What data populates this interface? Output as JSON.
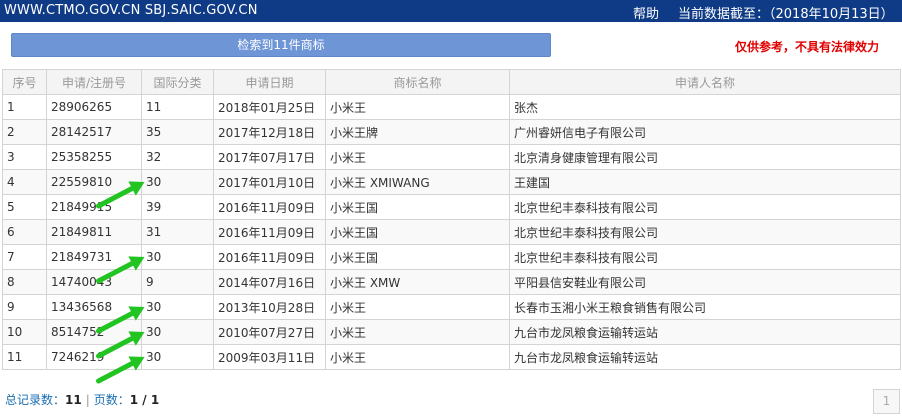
{
  "topbar": {
    "site": "WWW.CTMO.GOV.CN  SBJ.SAIC.GOV.CN",
    "help": "帮助",
    "as_of": "当前数据截至：（2018年10月13日）"
  },
  "search": {
    "result_label": "检索到11件商标",
    "disclaimer": "仅供参考，不具有法律效力"
  },
  "table": {
    "headers": [
      "序号",
      "申请/注册号",
      "国际分类",
      "申请日期",
      "商标名称",
      "申请人名称"
    ],
    "rows": [
      {
        "no": "1",
        "reg": "28906265",
        "cls": "11",
        "date": "2018年01月25日",
        "mark": "小米王",
        "applicant": "张杰"
      },
      {
        "no": "2",
        "reg": "28142517",
        "cls": "35",
        "date": "2017年12月18日",
        "mark": "小米王牌",
        "applicant": "广州睿妍信电子有限公司"
      },
      {
        "no": "3",
        "reg": "25358255",
        "cls": "32",
        "date": "2017年07月17日",
        "mark": "小米王",
        "applicant": "北京清身健康管理有限公司"
      },
      {
        "no": "4",
        "reg": "22559810",
        "cls": "30",
        "date": "2017年01月10日",
        "mark": "小米王 XMIWANG",
        "applicant": "王建国"
      },
      {
        "no": "5",
        "reg": "21849915",
        "cls": "39",
        "date": "2016年11月09日",
        "mark": "小米王国",
        "applicant": "北京世纪丰泰科技有限公司"
      },
      {
        "no": "6",
        "reg": "21849811",
        "cls": "31",
        "date": "2016年11月09日",
        "mark": "小米王国",
        "applicant": "北京世纪丰泰科技有限公司"
      },
      {
        "no": "7",
        "reg": "21849731",
        "cls": "30",
        "date": "2016年11月09日",
        "mark": "小米王国",
        "applicant": "北京世纪丰泰科技有限公司"
      },
      {
        "no": "8",
        "reg": "14740043",
        "cls": "9",
        "date": "2014年07月16日",
        "mark": "小米王 XMW",
        "applicant": "平阳县信安鞋业有限公司"
      },
      {
        "no": "9",
        "reg": "13436568",
        "cls": "30",
        "date": "2013年10月28日",
        "mark": "小米王",
        "applicant": "长春市玉湘小米王粮食销售有限公司"
      },
      {
        "no": "10",
        "reg": "8514752",
        "cls": "30",
        "date": "2010年07月27日",
        "mark": "小米王",
        "applicant": "九台市龙凤粮食运输转运站"
      },
      {
        "no": "11",
        "reg": "7246219",
        "cls": "30",
        "date": "2009年03月11日",
        "mark": "小米王",
        "applicant": "九台市龙凤粮食运输转运站"
      }
    ]
  },
  "annotations": {
    "arrow_color": "#22c422",
    "arrow_rows": [
      4,
      7,
      9,
      10,
      11
    ]
  },
  "footer": {
    "total_label": "总记录数：",
    "total_value": "11",
    "page_label": "页数：",
    "page_value": "1 / 1",
    "pager_current": "1"
  }
}
